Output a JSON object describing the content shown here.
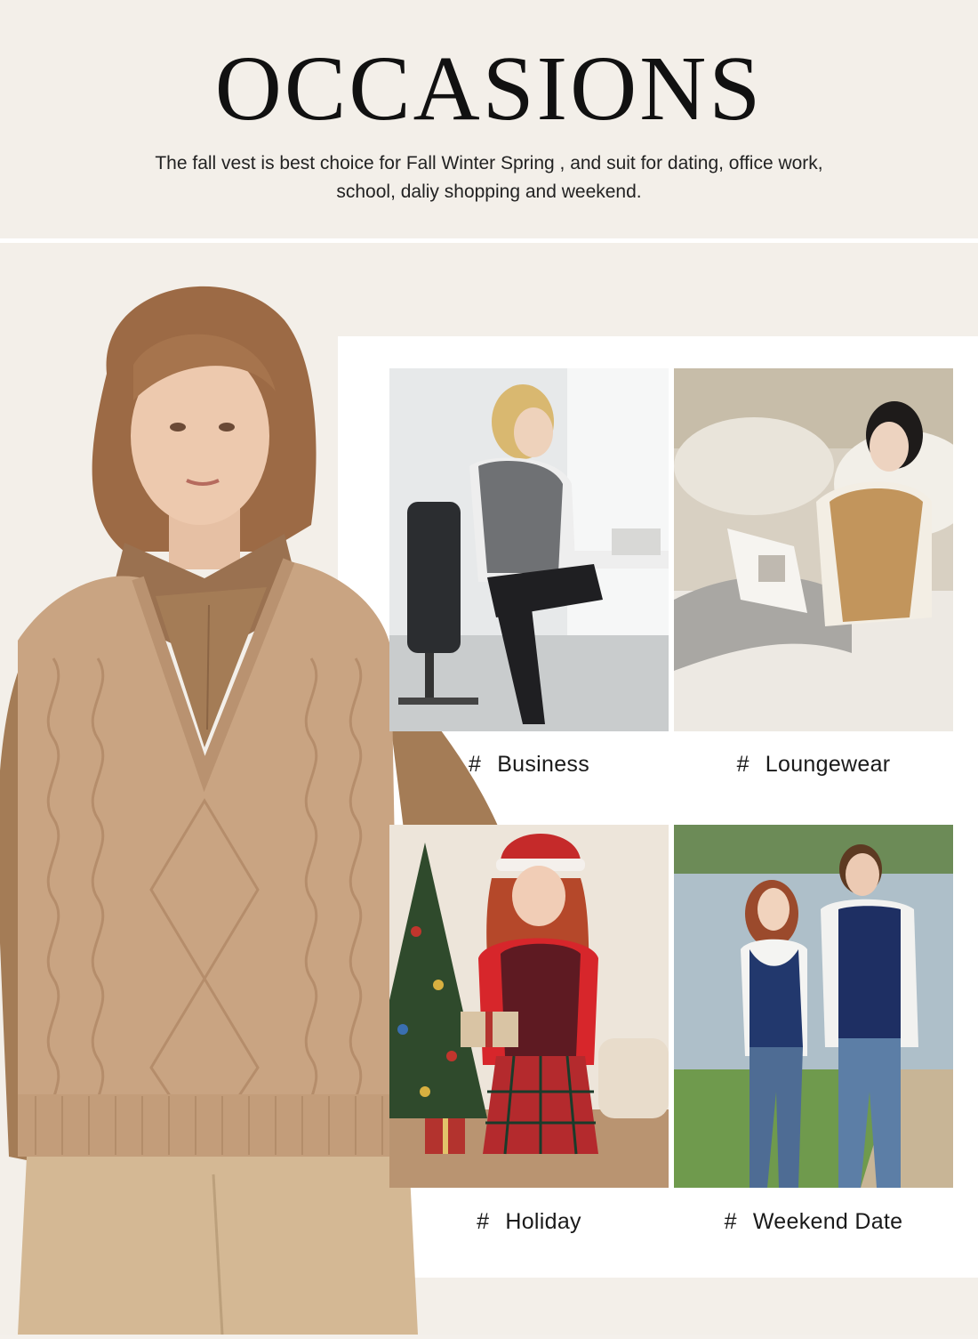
{
  "header": {
    "title": "OCCASIONS",
    "subtitle": "The fall vest is best choice for Fall Winter Spring , and suit for dating, office work, school, daliy shopping and weekend."
  },
  "occasions": [
    {
      "hash": "#",
      "label": "Business"
    },
    {
      "hash": "#",
      "label": "Loungewear"
    },
    {
      "hash": "#",
      "label": "Holiday"
    },
    {
      "hash": "#",
      "label": "Weekend Date"
    }
  ],
  "colors": {
    "background": "#f3efe9",
    "panel": "#ffffff",
    "vest_tan": "#c9a482",
    "shirt_brown": "#a47c56"
  }
}
